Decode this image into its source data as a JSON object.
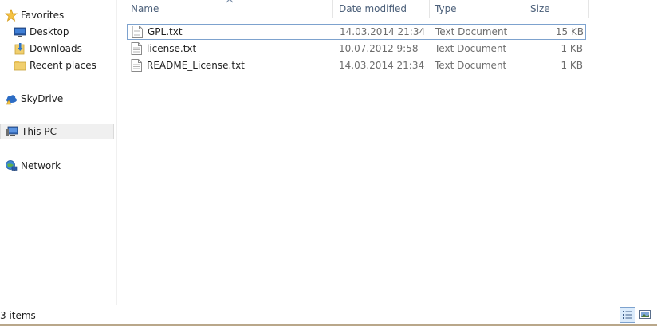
{
  "nav": {
    "favorites": "Favorites",
    "desktop": "Desktop",
    "downloads": "Downloads",
    "recent_places": "Recent places",
    "skydrive": "SkyDrive",
    "this_pc": "This PC",
    "network": "Network"
  },
  "columns": {
    "name": "Name",
    "date_modified": "Date modified",
    "type": "Type",
    "size": "Size"
  },
  "files": [
    {
      "name": "GPL.txt",
      "date": "14.03.2014 21:34",
      "type": "Text Document",
      "size": "15 KB"
    },
    {
      "name": "license.txt",
      "date": "10.07.2012 9:58",
      "type": "Text Document",
      "size": "1 KB"
    },
    {
      "name": "README_License.txt",
      "date": "14.03.2014 21:34",
      "type": "Text Document",
      "size": "1 KB"
    }
  ],
  "status": {
    "item_count": "3 items"
  },
  "colors": {
    "selection_border": "#7da2ce",
    "header_text": "#4c607a"
  }
}
